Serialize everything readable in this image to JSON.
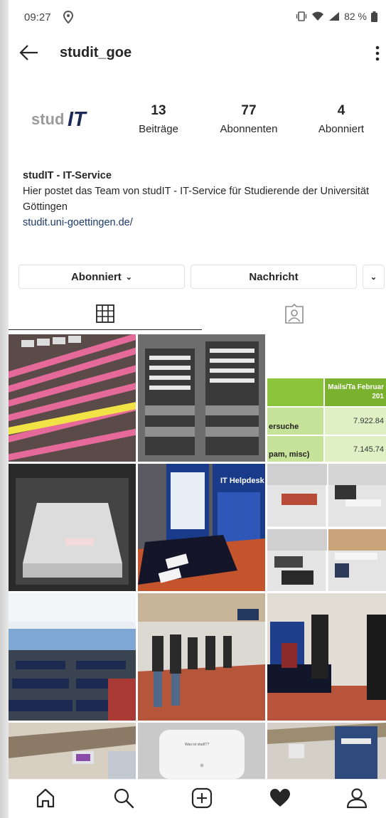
{
  "status": {
    "time": "09:27",
    "battery": "82 %"
  },
  "header": {
    "username": "studit_goe"
  },
  "profile": {
    "logo_text": "studIT",
    "stats": [
      {
        "num": "13",
        "label": "Beiträge"
      },
      {
        "num": "77",
        "label": "Abonnenten"
      },
      {
        "num": "4",
        "label": "Abonniert"
      }
    ],
    "bio_name": "studIT - IT-Service",
    "bio_text": "Hier postet das Team von studIT - IT-Service für Studierende der Universität Göttingen",
    "bio_link": "studit.uni-goettingen.de/"
  },
  "actions": {
    "following_label": "Abonniert",
    "message_label": "Nachricht"
  },
  "table_post": {
    "header": "Mails/Ta Februar 201",
    "row1_label": "ersuche",
    "row1_value": "7.922.84",
    "row2_label": "pam, misc)",
    "row2_value": "7.145.74"
  },
  "helpdesk_post": {
    "title": "IT Helpdesk",
    "logo": "IT"
  },
  "sign_post": {
    "text": "Was ist studIT?"
  },
  "nav_icons": [
    "home-icon",
    "search-icon",
    "add-icon",
    "heart-icon",
    "profile-icon"
  ]
}
